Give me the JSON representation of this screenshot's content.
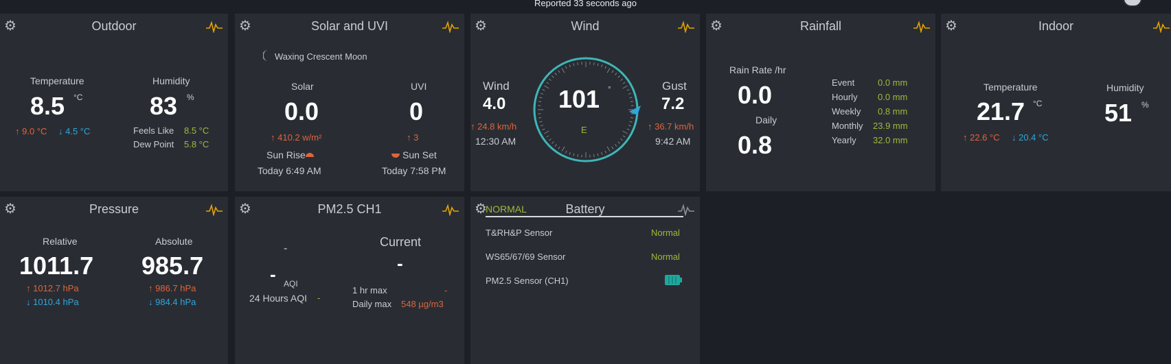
{
  "header": {
    "reported": "Reported 33 seconds ago"
  },
  "outdoor": {
    "title": "Outdoor",
    "temp_label": "Temperature",
    "temp_value": "8.5",
    "temp_unit": "°C",
    "temp_high": "↑ 9.0 °C",
    "temp_low": "↓ 4.5 °C",
    "hum_label": "Humidity",
    "hum_value": "83",
    "hum_unit": "%",
    "feels_label": "Feels Like",
    "feels_value": "8.5 °C",
    "dew_label": "Dew Point",
    "dew_value": "5.8 °C"
  },
  "solar": {
    "title": "Solar and UVI",
    "moon": "Waxing Crescent Moon",
    "solar_label": "Solar",
    "solar_value": "0.0",
    "solar_max": "↑ 410.2 w/m²",
    "uvi_label": "UVI",
    "uvi_value": "0",
    "uvi_max": "↑ 3",
    "sunrise_label": "Sun Rise",
    "sunrise_time": "Today 6:49 AM",
    "sunset_label": "Sun Set",
    "sunset_time": "Today 7:58 PM"
  },
  "wind": {
    "title": "Wind",
    "wind_label": "Wind",
    "wind_value": "4.0",
    "wind_max": "↑ 24.8 km/h",
    "wind_time": "12:30 AM",
    "dir_value": "101",
    "dir_unit": "°",
    "dir_cardinal": "E",
    "gust_label": "Gust",
    "gust_value": "7.2",
    "gust_max": "↑ 36.7 km/h",
    "gust_time": "9:42 AM"
  },
  "rainfall": {
    "title": "Rainfall",
    "rate_label": "Rain Rate /hr",
    "rate_value": "0.0",
    "daily_label": "Daily",
    "daily_value": "0.8",
    "rows": [
      {
        "label": "Event",
        "value": "0.0 mm"
      },
      {
        "label": "Hourly",
        "value": "0.0 mm"
      },
      {
        "label": "Weekly",
        "value": "0.8 mm"
      },
      {
        "label": "Monthly",
        "value": "23.9 mm"
      },
      {
        "label": "Yearly",
        "value": "32.0 mm"
      }
    ]
  },
  "indoor": {
    "title": "Indoor",
    "temp_label": "Temperature",
    "temp_value": "21.7",
    "temp_unit": "°C",
    "temp_high": "↑ 22.6 °C",
    "temp_low": "↓ 20.4 °C",
    "hum_label": "Humidity",
    "hum_value": "51",
    "hum_unit": "%"
  },
  "pressure": {
    "title": "Pressure",
    "rel_label": "Relative",
    "rel_value": "1011.7",
    "rel_high": "↑ 1012.7 hPa",
    "rel_low": "↓ 1010.4 hPa",
    "abs_label": "Absolute",
    "abs_value": "985.7",
    "abs_high": "↑ 986.7 hPa",
    "abs_low": "↓ 984.4 hPa"
  },
  "pm25": {
    "title": "PM2.5 CH1",
    "aqi_top": "-",
    "aqi_value": "-",
    "aqi_label": "AQI",
    "aqi24_label": "24 Hours AQI",
    "aqi24_value": "-",
    "current_label": "Current",
    "current_value": "-",
    "hr_max_label": "1 hr max",
    "hr_max_value": "-",
    "daily_max_label": "Daily max",
    "daily_max_value": "548 µg/m3"
  },
  "battery": {
    "title": "Battery",
    "status": "NORMAL",
    "rows": [
      {
        "label": "T&RH&P Sensor",
        "value": "Normal"
      },
      {
        "label": "WS65/67/69 Sensor",
        "value": "Normal"
      },
      {
        "label": "PM2.5 Sensor (CH1)",
        "value": ""
      }
    ]
  },
  "colors": {
    "accent_red": "#e0643b",
    "accent_blue": "#2fa6dc",
    "accent_green": "#a3b83a",
    "spark_gold": "#e6a400",
    "compass": "#3fb6b8"
  }
}
